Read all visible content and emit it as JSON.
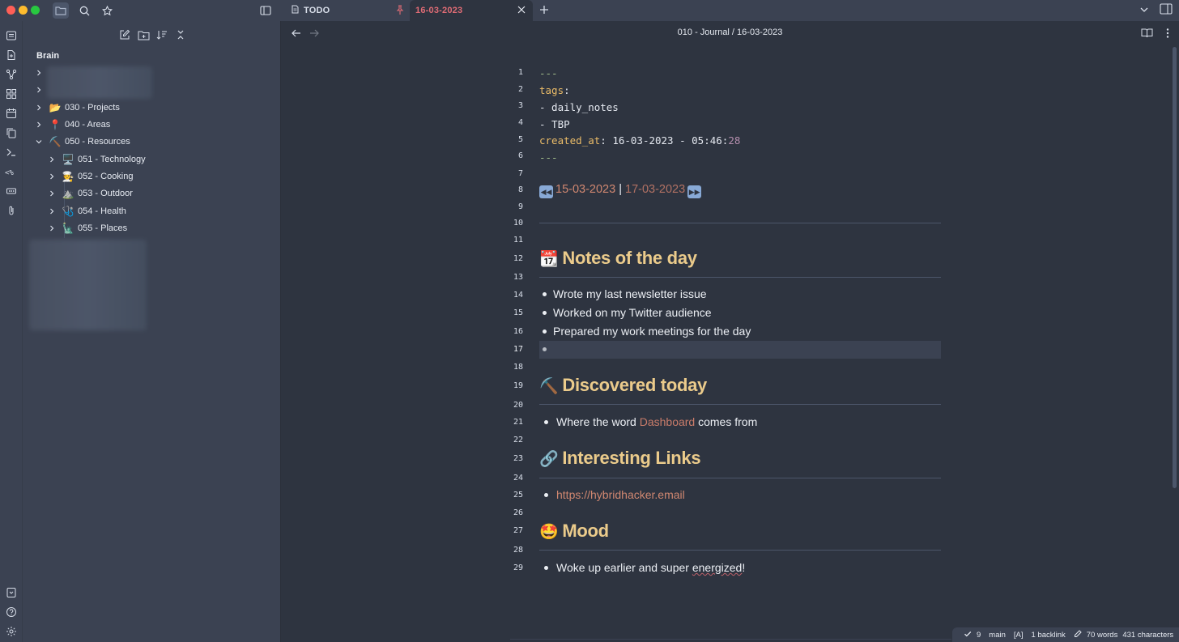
{
  "tabs": [
    {
      "label": "TODO"
    },
    {
      "label": "16-03-2023",
      "active": true
    }
  ],
  "sidebar": {
    "vault": "Brain",
    "tree": [
      {
        "label": "",
        "blurred": true
      },
      {
        "label": "",
        "blurred": true
      },
      {
        "emoji": "📂",
        "label": "030 - Projects"
      },
      {
        "emoji": "📍",
        "label": "040 - Areas"
      },
      {
        "emoji": "⛏️",
        "label": "050 - Resources",
        "expanded": true
      },
      {
        "emoji": "🖥️",
        "label": "051 - Technology"
      },
      {
        "emoji": "🧑‍🍳",
        "label": "052 - Cooking"
      },
      {
        "emoji": "⛰️",
        "label": "053 - Outdoor"
      },
      {
        "emoji": "🩺",
        "label": "054 - Health"
      },
      {
        "emoji": "🗽",
        "label": "055 - Places"
      }
    ]
  },
  "editor": {
    "breadcrumb": "010 - Journal / 16-03-2023",
    "line_numbers": [
      "1",
      "2",
      "3",
      "4",
      "5",
      "6",
      "7",
      "8",
      "9",
      "10",
      "11",
      "12",
      "13",
      "14",
      "15",
      "16",
      "17",
      "18",
      "19",
      "20",
      "21",
      "22",
      "23",
      "24",
      "25",
      "26",
      "27",
      "28",
      "29"
    ],
    "current_line": 17,
    "frontmatter": {
      "dashes": "---",
      "tags_key": "tags",
      "colon": ":",
      "tag1": "- daily_notes",
      "tag2": "- TBP",
      "created_key": "created_at",
      "created_val": ": 16-03-2023 - 05:46:",
      "created_secs": "28"
    },
    "nav": {
      "prev": "15-03-2023",
      "sep": "|",
      "next": "17-03-2023"
    },
    "sections": {
      "notes_emoji": "📆",
      "notes_title": "Notes of the day",
      "notes_items": [
        "Wrote my last newsletter issue",
        "Worked on my Twitter audience",
        "Prepared my work meetings for the day"
      ],
      "discovered_emoji": "⛏️",
      "discovered_title": "Discovered today",
      "discovered_pre": "Where the word ",
      "discovered_link": "Dashboard",
      "discovered_post": " comes from",
      "links_emoji": "🔗",
      "links_title": "Interesting Links",
      "links_url": "https://hybridhacker.email",
      "mood_emoji": "🤩",
      "mood_title": "Mood",
      "mood_pre": "Woke up earlier and super ",
      "mood_word": "energized",
      "mood_post": "!"
    }
  },
  "status": {
    "sync": "9",
    "branch": "main",
    "mode": "[A]",
    "backlinks": "1 backlink",
    "words": "70 words",
    "chars": "431 characters"
  },
  "colors": {
    "accent": "#e06c75",
    "heading": "#ebcb8b",
    "link": "#d08770",
    "background": "#2e3440",
    "panel": "#3b4252"
  }
}
